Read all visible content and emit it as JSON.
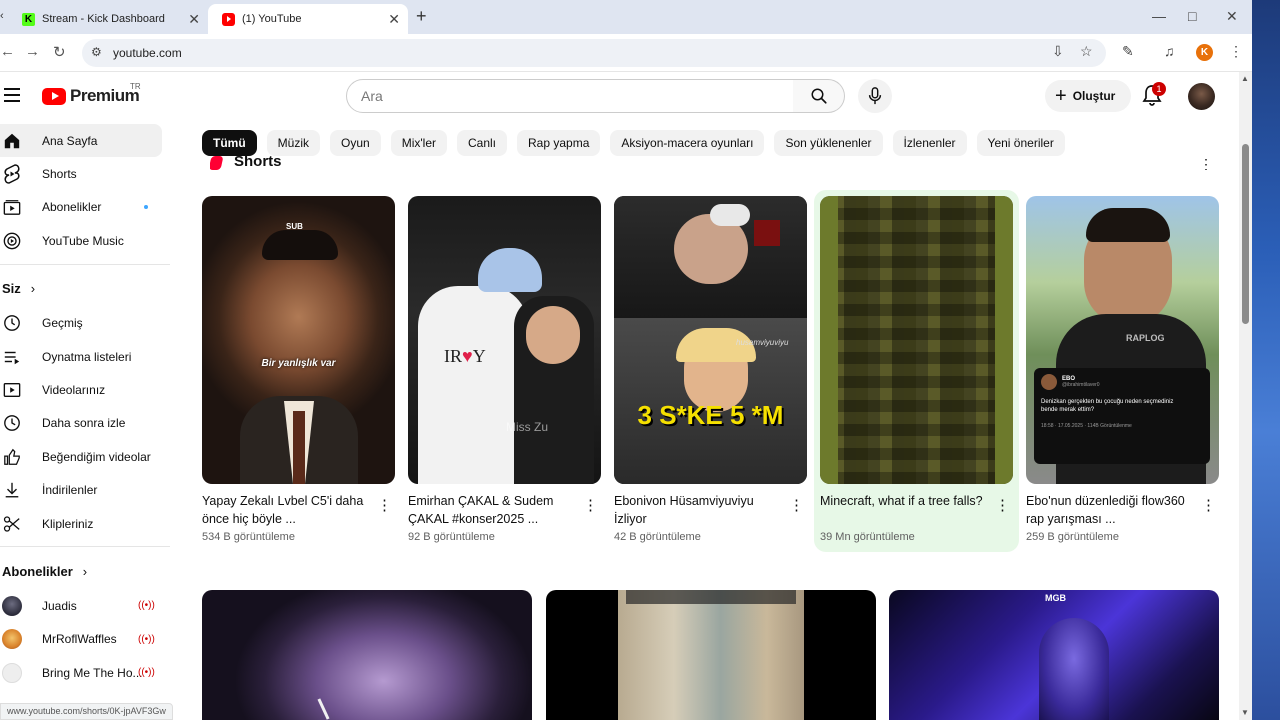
{
  "browser": {
    "tabs": [
      {
        "title": "Stream - Kick Dashboard",
        "favicon": "kick-favicon",
        "favicon_letter": "K"
      },
      {
        "title": "(1) YouTube",
        "favicon": "youtube-favicon"
      }
    ],
    "url": "youtube.com",
    "profile_initial": "K"
  },
  "header": {
    "logo_text": "Premium",
    "country_code": "TR",
    "search_placeholder": "Ara",
    "create_label": "Oluştur",
    "notification_count": "1"
  },
  "sidebar": {
    "main": [
      {
        "label": "Ana Sayfa",
        "icon": "home-icon"
      },
      {
        "label": "Shorts",
        "icon": "shorts-icon"
      },
      {
        "label": "Abonelikler",
        "icon": "subscriptions-icon"
      },
      {
        "label": "YouTube Music",
        "icon": "youtube-music-icon"
      }
    ],
    "you_title": "Siz",
    "you": [
      {
        "label": "Geçmiş",
        "icon": "history-icon"
      },
      {
        "label": "Oynatma listeleri",
        "icon": "playlists-icon"
      },
      {
        "label": "Videolarınız",
        "icon": "your-videos-icon"
      },
      {
        "label": "Daha sonra izle",
        "icon": "watch-later-icon"
      },
      {
        "label": "Beğendiğim videolar",
        "icon": "liked-videos-icon"
      },
      {
        "label": "İndirilenler",
        "icon": "downloads-icon"
      },
      {
        "label": "Klipleriniz",
        "icon": "clips-icon"
      }
    ],
    "subs_title": "Abonelikler",
    "subs": [
      {
        "label": "Juadis",
        "color": "#2b2b3a"
      },
      {
        "label": "MrRoflWaffles",
        "color": "#d9822b"
      },
      {
        "label": "Bring Me The Ho...",
        "color": "#e6e6e6"
      }
    ],
    "status_url": "www.youtube.com/shorts/0K-jpAVF3Gw"
  },
  "chips": [
    "Tümü",
    "Müzik",
    "Oyun",
    "Mix'ler",
    "Canlı",
    "Rap yapma",
    "Aksiyon-macera oyunları",
    "Son yüklenenler",
    "İzlenenler",
    "Yeni öneriler"
  ],
  "shorts": {
    "title": "Shorts",
    "items": [
      {
        "title": "Yapay Zekalı Lvbel C5'i daha önce hiç böyle ...",
        "views": "534 B görüntüleme",
        "overlay": "Bir yanlışlık var",
        "badge": "SUB"
      },
      {
        "title": "Emirhan ÇAKAL & Sudem ÇAKAL #konser2025 ...",
        "views": "92 B görüntüleme",
        "overlay": "Miss Zu"
      },
      {
        "title": "Ebonivon Hüsamviyuviyu İzliyor",
        "views": "42 B görüntüleme",
        "overlay": "3 S*KE 5 *M",
        "watermark": "husamviyuviyu"
      },
      {
        "title": "Minecraft, what if a tree falls?",
        "views": "39 Mn görüntüleme"
      },
      {
        "title": "Ebo'nun düzenlediği flow360 rap yarışması ...",
        "views": "259 B görüntüleme",
        "tweet_name": "EBO",
        "tweet_handle": "@ibrahimtilaver0",
        "tweet_text": "Denizkan gerçekten bu çocuğu neden seçmediniz bende merak ettim?",
        "tweet_meta": "18:58 · 17.05.2025 · 114B Görüntülenme",
        "watermark": "RAPLOG"
      }
    ]
  },
  "videos": [
    {
      "thumb": "purple-portrait"
    },
    {
      "thumb": "cs-map"
    },
    {
      "thumb": "blue-neon",
      "badge": "MGB"
    }
  ]
}
